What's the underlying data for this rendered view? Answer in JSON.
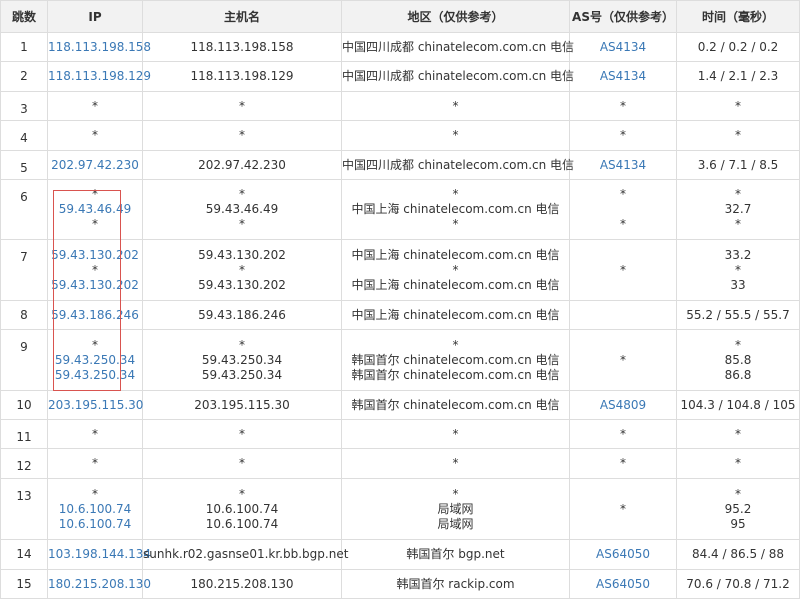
{
  "headers": [
    "跳数",
    "IP",
    "主机名",
    "地区（仅供参考）",
    "AS号（仅供参考）",
    "时间（毫秒）"
  ],
  "colors": {
    "link": "#3a78b5",
    "highlight_box": "#d9534f",
    "header_bg": "#f2f2f2",
    "border": "#dddddd"
  },
  "rows": [
    {
      "hop": "1",
      "ip": [
        "118.113.198.158"
      ],
      "host": [
        "118.113.198.158"
      ],
      "region": [
        "中国四川成都 chinatelecom.com.cn 电信"
      ],
      "as": [
        "AS4134"
      ],
      "time": [
        "0.2 / 0.2 / 0.2"
      ]
    },
    {
      "hop": "2",
      "ip": [
        "118.113.198.129"
      ],
      "host": [
        "118.113.198.129"
      ],
      "region": [
        "中国四川成都 chinatelecom.com.cn 电信"
      ],
      "as": [
        "AS4134"
      ],
      "time": [
        "1.4 / 2.1 / 2.3"
      ]
    },
    {
      "hop": "3",
      "ip": [
        "*"
      ],
      "host": [
        "*"
      ],
      "region": [
        "*"
      ],
      "as": [
        "*"
      ],
      "time": [
        "*"
      ]
    },
    {
      "hop": "4",
      "ip": [
        "*"
      ],
      "host": [
        "*"
      ],
      "region": [
        "*"
      ],
      "as": [
        "*"
      ],
      "time": [
        "*"
      ]
    },
    {
      "hop": "5",
      "ip": [
        "202.97.42.230"
      ],
      "host": [
        "202.97.42.230"
      ],
      "region": [
        "中国四川成都 chinatelecom.com.cn 电信"
      ],
      "as": [
        "AS4134"
      ],
      "time": [
        "3.6 / 7.1 / 8.5"
      ]
    },
    {
      "hop": "6",
      "ip": [
        "*",
        "59.43.46.49",
        "*"
      ],
      "host": [
        "*",
        "59.43.46.49",
        "*"
      ],
      "region": [
        "*",
        "中国上海 chinatelecom.com.cn 电信",
        "*"
      ],
      "as": [
        "*",
        "",
        "*"
      ],
      "time": [
        "*",
        "32.7",
        "*"
      ]
    },
    {
      "hop": "7",
      "ip": [
        "59.43.130.202",
        "*",
        "59.43.130.202"
      ],
      "host": [
        "59.43.130.202",
        "*",
        "59.43.130.202"
      ],
      "region": [
        "中国上海 chinatelecom.com.cn 电信",
        "*",
        "中国上海 chinatelecom.com.cn 电信"
      ],
      "as": [
        "*"
      ],
      "time": [
        "33.2",
        "*",
        "33"
      ]
    },
    {
      "hop": "8",
      "ip": [
        "59.43.186.246"
      ],
      "host": [
        "59.43.186.246"
      ],
      "region": [
        "中国上海 chinatelecom.com.cn 电信"
      ],
      "as": [
        ""
      ],
      "time": [
        "55.2 / 55.5 / 55.7"
      ]
    },
    {
      "hop": "9",
      "ip": [
        "*",
        "59.43.250.34",
        "59.43.250.34"
      ],
      "host": [
        "*",
        "59.43.250.34",
        "59.43.250.34"
      ],
      "region": [
        "*",
        "韩国首尔 chinatelecom.com.cn 电信",
        "韩国首尔 chinatelecom.com.cn 电信"
      ],
      "as": [
        "*"
      ],
      "time": [
        "*",
        "85.8",
        "86.8"
      ]
    },
    {
      "hop": "10",
      "ip": [
        "203.195.115.30"
      ],
      "host": [
        "203.195.115.30"
      ],
      "region": [
        "韩国首尔 chinatelecom.com.cn 电信"
      ],
      "as": [
        "AS4809"
      ],
      "time": [
        "104.3 / 104.8 / 105"
      ]
    },
    {
      "hop": "11",
      "ip": [
        "*"
      ],
      "host": [
        "*"
      ],
      "region": [
        "*"
      ],
      "as": [
        "*"
      ],
      "time": [
        "*"
      ]
    },
    {
      "hop": "12",
      "ip": [
        "*"
      ],
      "host": [
        "*"
      ],
      "region": [
        "*"
      ],
      "as": [
        "*"
      ],
      "time": [
        "*"
      ]
    },
    {
      "hop": "13",
      "ip": [
        "*",
        "10.6.100.74",
        "10.6.100.74"
      ],
      "host": [
        "*",
        "10.6.100.74",
        "10.6.100.74"
      ],
      "region": [
        "*",
        "局域网",
        "局域网"
      ],
      "as": [
        "*"
      ],
      "time": [
        "*",
        "95.2",
        "95"
      ]
    },
    {
      "hop": "14",
      "ip": [
        "103.198.144.134"
      ],
      "host": [
        "sunhk.r02.gasnse01.kr.bb.bgp.net"
      ],
      "region": [
        "韩国首尔 bgp.net"
      ],
      "as": [
        "AS64050"
      ],
      "time": [
        "84.4 / 86.5 / 88"
      ]
    },
    {
      "hop": "15",
      "ip": [
        "180.215.208.130"
      ],
      "host": [
        "180.215.208.130"
      ],
      "region": [
        "韩国首尔 rackip.com"
      ],
      "as": [
        "AS64050"
      ],
      "time": [
        "70.6 / 70.8 / 71.2"
      ]
    }
  ]
}
